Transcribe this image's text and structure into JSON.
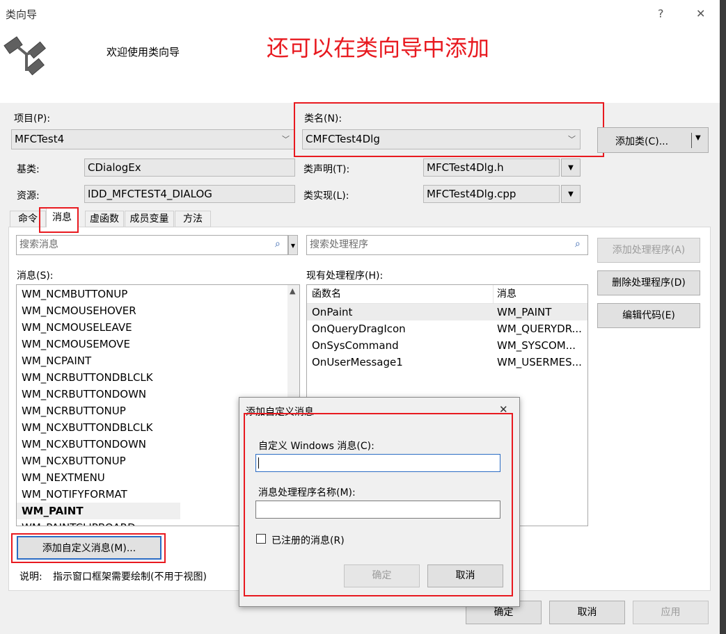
{
  "window": {
    "title": "类向导",
    "help": "?",
    "close": "✕"
  },
  "header": {
    "welcome": "欢迎使用类向导",
    "annotation": "还可以在类向导中添加"
  },
  "form": {
    "project_label": "项目(P):",
    "project_value": "MFCTest4",
    "classname_label": "类名(N):",
    "classname_value": "CMFCTest4Dlg",
    "add_class": "添加类(C)...",
    "base_label": "基类:",
    "base_value": "CDialogEx",
    "decl_label": "类声明(T):",
    "decl_value": "MFCTest4Dlg.h",
    "res_label": "资源:",
    "res_value": "IDD_MFCTEST4_DIALOG",
    "impl_label": "类实现(L):",
    "impl_value": "MFCTest4Dlg.cpp"
  },
  "tabs": [
    "命令",
    "消息",
    "虚函数",
    "成员变量",
    "方法"
  ],
  "messages": {
    "search_placeholder": "搜索消息",
    "handler_search_placeholder": "搜索处理程序",
    "list_label": "消息(S):",
    "items": [
      "WM_NCMBUTTONUP",
      "WM_NCMOUSEHOVER",
      "WM_NCMOUSELEAVE",
      "WM_NCMOUSEMOVE",
      "WM_NCPAINT",
      "WM_NCRBUTTONDBLCLK",
      "WM_NCRBUTTONDOWN",
      "WM_NCRBUTTONUP",
      "WM_NCXBUTTONDBLCLK",
      "WM_NCXBUTTONDOWN",
      "WM_NCXBUTTONUP",
      "WM_NEXTMENU",
      "WM_NOTIFYFORMAT",
      "WM_PAINT",
      "WM_PAINTCLIPBOARD"
    ],
    "selected": "WM_PAINT",
    "handlers_label": "现有处理程序(H):",
    "handlers_columns": [
      "函数名",
      "消息"
    ],
    "handlers": [
      [
        "OnPaint",
        "WM_PAINT"
      ],
      [
        "OnQueryDragIcon",
        "WM_QUERYDR..."
      ],
      [
        "OnSysCommand",
        "WM_SYSCOM..."
      ],
      [
        "OnUserMessage1",
        "WM_USERMES..."
      ]
    ],
    "add_handler": "添加处理程序(A)",
    "delete_handler": "删除处理程序(D)",
    "edit_code": "编辑代码(E)",
    "add_custom": "添加自定义消息(M)...",
    "desc_label": "说明:",
    "desc_value": "指示窗口框架需要绘制(不用于视图)"
  },
  "footer": {
    "ok": "确定",
    "cancel": "取消",
    "apply": "应用"
  },
  "dialog": {
    "title": "添加自定义消息",
    "close": "✕",
    "msg_label": "自定义 Windows 消息(C):",
    "msg_value": "",
    "handler_label": "消息处理程序名称(M):",
    "handler_value": "",
    "registered_label": "已注册的消息(R)",
    "registered_checked": false,
    "ok": "确定",
    "cancel": "取消"
  },
  "colors": {
    "annotation": "#e8191f",
    "window_bg": "#f0f0f0"
  },
  "icons": {
    "logo": "class-wizard-icon",
    "search": "search-icon",
    "dropdown": "chevron-down-icon"
  }
}
